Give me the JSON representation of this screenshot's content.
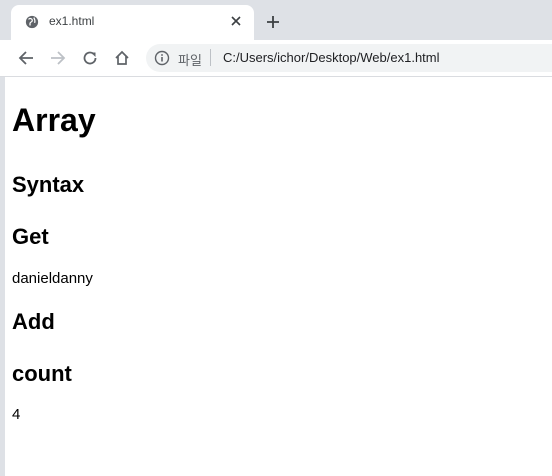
{
  "browser": {
    "tab_title": "ex1.html",
    "new_tab_label": "+",
    "address_scheme": "파일",
    "address_url": "C:/Users/ichor/Desktop/Web/ex1.html"
  },
  "page": {
    "title": "Array",
    "sections": [
      {
        "heading": "Syntax"
      },
      {
        "heading": "Get",
        "output": "danieldanny"
      },
      {
        "heading": "Add"
      },
      {
        "heading": "count",
        "output": "4"
      }
    ]
  },
  "colors": {
    "tabstrip_bg": "#dee1e6",
    "omnibox_bg": "#f1f3f4",
    "accent_edge": "#1a73e8"
  }
}
